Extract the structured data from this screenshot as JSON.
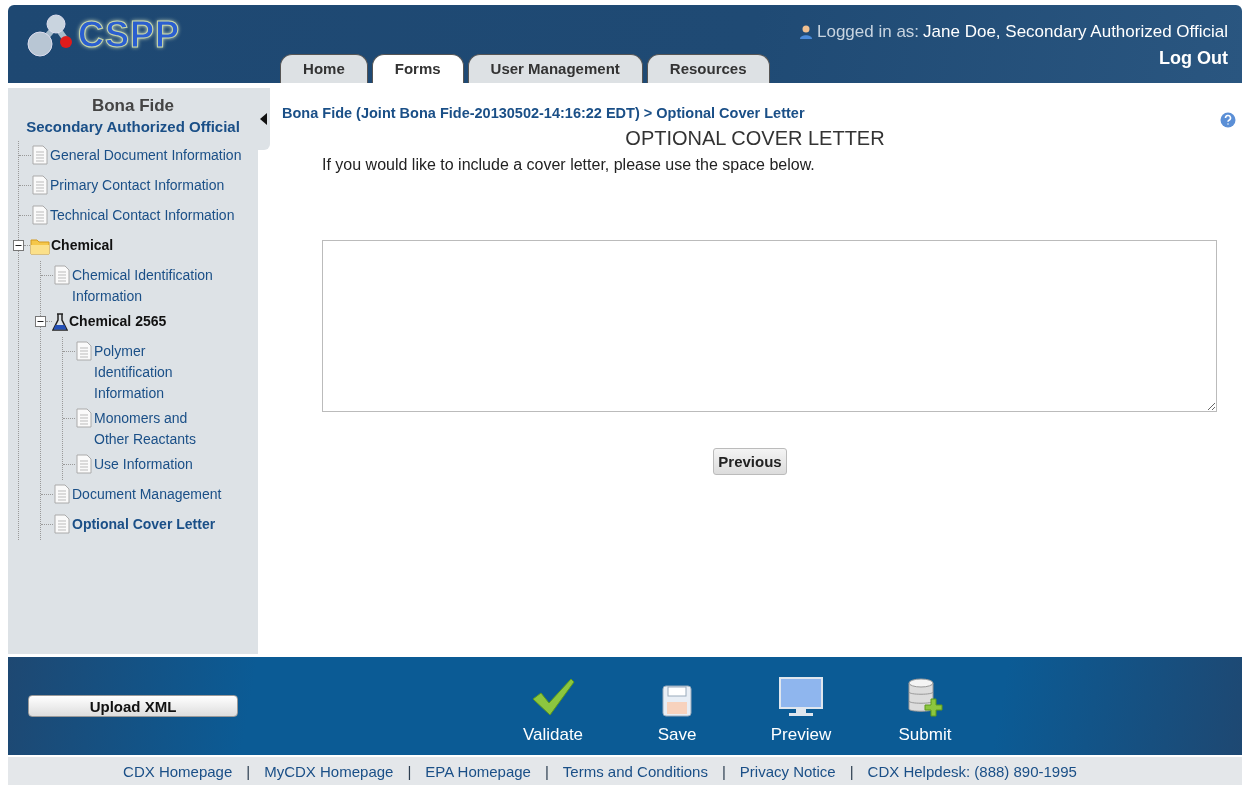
{
  "header": {
    "logo_text": "CSPP",
    "logged_in_label": "Logged in as:",
    "user": "Jane Doe, Secondary Authorized Official",
    "logout": "Log Out"
  },
  "tabs": [
    {
      "label": "Home",
      "selected": false
    },
    {
      "label": "Forms",
      "selected": true
    },
    {
      "label": "User Management",
      "selected": false
    },
    {
      "label": "Resources",
      "selected": false
    }
  ],
  "sidebar": {
    "title": "Bona Fide",
    "subtitle": "Secondary Authorized Official",
    "items": [
      {
        "label": "General Document Information",
        "kind": "doc",
        "selected": false
      },
      {
        "label": "Primary Contact Information",
        "kind": "doc",
        "selected": false
      },
      {
        "label": "Technical Contact Information",
        "kind": "doc",
        "selected": false
      },
      {
        "label": "Chemical",
        "kind": "folder",
        "expanded": true,
        "children": [
          {
            "label": "Chemical Identification Information",
            "kind": "doc",
            "selected": false
          },
          {
            "label": "Chemical 2565",
            "kind": "flask",
            "expanded": true,
            "children": [
              {
                "label": "Polymer Identification Information",
                "kind": "doc",
                "selected": false
              },
              {
                "label": "Monomers and Other Reactants",
                "kind": "doc",
                "selected": false
              },
              {
                "label": "Use Information",
                "kind": "doc",
                "selected": false
              }
            ]
          },
          {
            "label": "Document Management",
            "kind": "doc",
            "selected": false
          },
          {
            "label": "Optional Cover Letter",
            "kind": "doc",
            "selected": true
          }
        ]
      }
    ]
  },
  "main": {
    "breadcrumb": "Bona Fide (Joint Bona Fide-20130502-14:16:22 EDT) > Optional Cover Letter",
    "title": "OPTIONAL COVER LETTER",
    "instructions": "If you would like to include a cover letter, please use the space below.",
    "previous_button": "Previous"
  },
  "toolbar": {
    "upload_button": "Upload XML",
    "actions": [
      {
        "label": "Validate",
        "kind": "check"
      },
      {
        "label": "Save",
        "kind": "disk"
      },
      {
        "label": "Preview",
        "kind": "monitor"
      },
      {
        "label": "Submit",
        "kind": "database"
      }
    ]
  },
  "footer_links": [
    {
      "label": "CDX Homepage",
      "kind": "link"
    },
    {
      "label": "|",
      "kind": "separator"
    },
    {
      "label": "MyCDX Homepage",
      "kind": "link"
    },
    {
      "label": "|",
      "kind": "separator"
    },
    {
      "label": "EPA Homepage",
      "kind": "link"
    },
    {
      "label": "|",
      "kind": "separator"
    },
    {
      "label": "Terms and Conditions",
      "kind": "link"
    },
    {
      "label": "|",
      "kind": "separator"
    },
    {
      "label": "Privacy Notice",
      "kind": "link"
    },
    {
      "label": "|",
      "kind": "separator"
    },
    {
      "label": "CDX Helpdesk: (888) 890-1995",
      "kind": "link"
    }
  ]
}
